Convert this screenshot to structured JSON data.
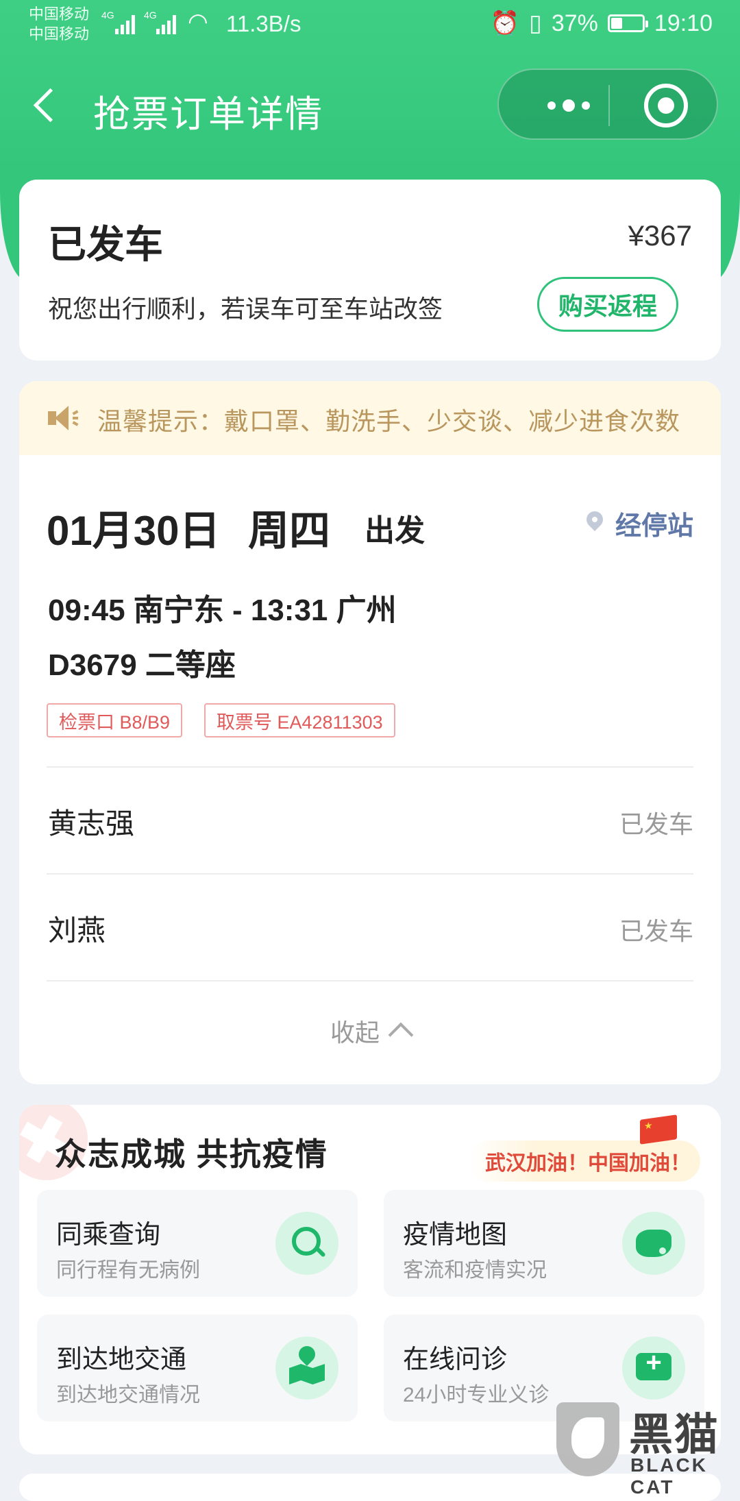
{
  "status_bar": {
    "carrier1": "中国移动",
    "carrier2": "中国移动",
    "network1": "4G",
    "network2": "4G",
    "speed": "11.3B/s",
    "battery": "37%",
    "battery_level": 0.37,
    "time": "19:10"
  },
  "nav": {
    "title": "抢票订单详情",
    "icons": [
      "back-icon",
      "more-icon",
      "target-icon"
    ]
  },
  "status": {
    "title": "已发车",
    "price": "¥367",
    "subtitle": "祝您出行顺利，若误车可至车站改签",
    "return_button": "购买返程"
  },
  "notice": {
    "text": "温馨提示：戴口罩、勤洗手、少交谈、减少进食次数"
  },
  "trip": {
    "date": "01月30日",
    "weekday": "周四",
    "depart_label": "出发",
    "stops_link": "经停站",
    "route": "09:45 南宁东 - 13:31 广州",
    "train": "D3679  二等座",
    "tags": [
      "检票口 B8/B9",
      "取票号 EA42811303"
    ]
  },
  "passengers": [
    {
      "name": "黄志强",
      "status": "已发车"
    },
    {
      "name": "刘燕",
      "status": "已发车"
    }
  ],
  "collapse_label": "收起",
  "epidemic": {
    "title": "众志成城 共抗疫情",
    "cheer": "武汉加油！中国加油！",
    "tiles": [
      {
        "title": "同乘查询",
        "subtitle": "同行程有无病例",
        "icon": "search-icon"
      },
      {
        "title": "疫情地图",
        "subtitle": "客流和疫情实况",
        "icon": "china-map-icon"
      },
      {
        "title": "到达地交通",
        "subtitle": "到达地交通情况",
        "icon": "route-map-icon"
      },
      {
        "title": "在线问诊",
        "subtitle": "24小时专业义诊",
        "icon": "medical-chat-icon"
      }
    ]
  },
  "watermark": {
    "cn": "黑猫",
    "en": "BLACK CAT"
  },
  "colors": {
    "brand_green": "#34c77c",
    "notice_text": "#b8965e",
    "tag_red": "#e05a5a",
    "link_blue": "#6078a8"
  }
}
